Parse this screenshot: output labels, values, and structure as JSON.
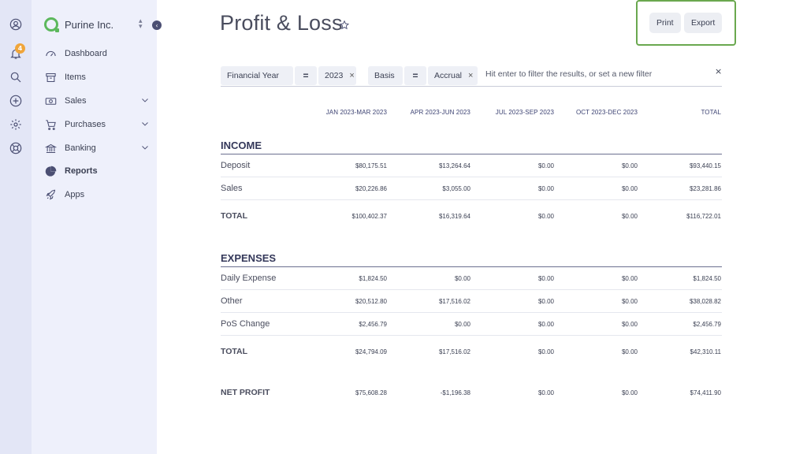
{
  "rail": {
    "notification_count": "4"
  },
  "sidebar": {
    "org_name": "Purine Inc.",
    "items": [
      {
        "label": "Dashboard",
        "icon": "dashboard-icon"
      },
      {
        "label": "Items",
        "icon": "archive-icon"
      },
      {
        "label": "Sales",
        "icon": "sales-icon",
        "expandable": true
      },
      {
        "label": "Purchases",
        "icon": "cart-icon",
        "expandable": true
      },
      {
        "label": "Banking",
        "icon": "bank-icon",
        "expandable": true
      },
      {
        "label": "Reports",
        "icon": "pie-chart-icon",
        "active": true
      },
      {
        "label": "Apps",
        "icon": "rocket-icon"
      }
    ]
  },
  "page": {
    "title": "Profit & Loss",
    "print_label": "Print",
    "export_label": "Export"
  },
  "filters": {
    "chips": [
      {
        "field": "Financial Year",
        "operator": "=",
        "value": "2023"
      },
      {
        "field": "Basis",
        "operator": "=",
        "value": "Accrual"
      }
    ],
    "placeholder": "Hit enter to filter the results, or set a new filter",
    "clear_symbol": "×",
    "remove_symbol": "×"
  },
  "table": {
    "columns": [
      "JAN 2023-MAR 2023",
      "APR 2023-JUN 2023",
      "JUL 2023-SEP 2023",
      "OCT 2023-DEC 2023",
      "TOTAL"
    ],
    "income": {
      "title": "INCOME",
      "rows": [
        {
          "label": "Deposit",
          "values": [
            "$80,175.51",
            "$13,264.64",
            "$0.00",
            "$0.00",
            "$93,440.15"
          ]
        },
        {
          "label": "Sales",
          "values": [
            "$20,226.86",
            "$3,055.00",
            "$0.00",
            "$0.00",
            "$23,281.86"
          ]
        }
      ],
      "total": {
        "label": "TOTAL",
        "values": [
          "$100,402.37",
          "$16,319.64",
          "$0.00",
          "$0.00",
          "$116,722.01"
        ]
      }
    },
    "expenses": {
      "title": "EXPENSES",
      "rows": [
        {
          "label": "Daily Expense",
          "values": [
            "$1,824.50",
            "$0.00",
            "$0.00",
            "$0.00",
            "$1,824.50"
          ]
        },
        {
          "label": "Other",
          "values": [
            "$20,512.80",
            "$17,516.02",
            "$0.00",
            "$0.00",
            "$38,028.82"
          ]
        },
        {
          "label": "PoS Change",
          "values": [
            "$2,456.79",
            "$0.00",
            "$0.00",
            "$0.00",
            "$2,456.79"
          ]
        }
      ],
      "total": {
        "label": "TOTAL",
        "values": [
          "$24,794.09",
          "$17,516.02",
          "$0.00",
          "$0.00",
          "$42,310.11"
        ]
      }
    },
    "net_profit": {
      "label": "NET PROFIT",
      "values": [
        "$75,608.28",
        "-$1,196.38",
        "$0.00",
        "$0.00",
        "$74,411.90"
      ]
    }
  },
  "colors": {
    "rail_bg": "#e3e6f6",
    "sidebar_bg": "#eef0fb",
    "accent": "#4b4f73",
    "brand_green": "#5cb85c",
    "badge": "#f0a53a",
    "highlight_border": "#6aa84f"
  }
}
